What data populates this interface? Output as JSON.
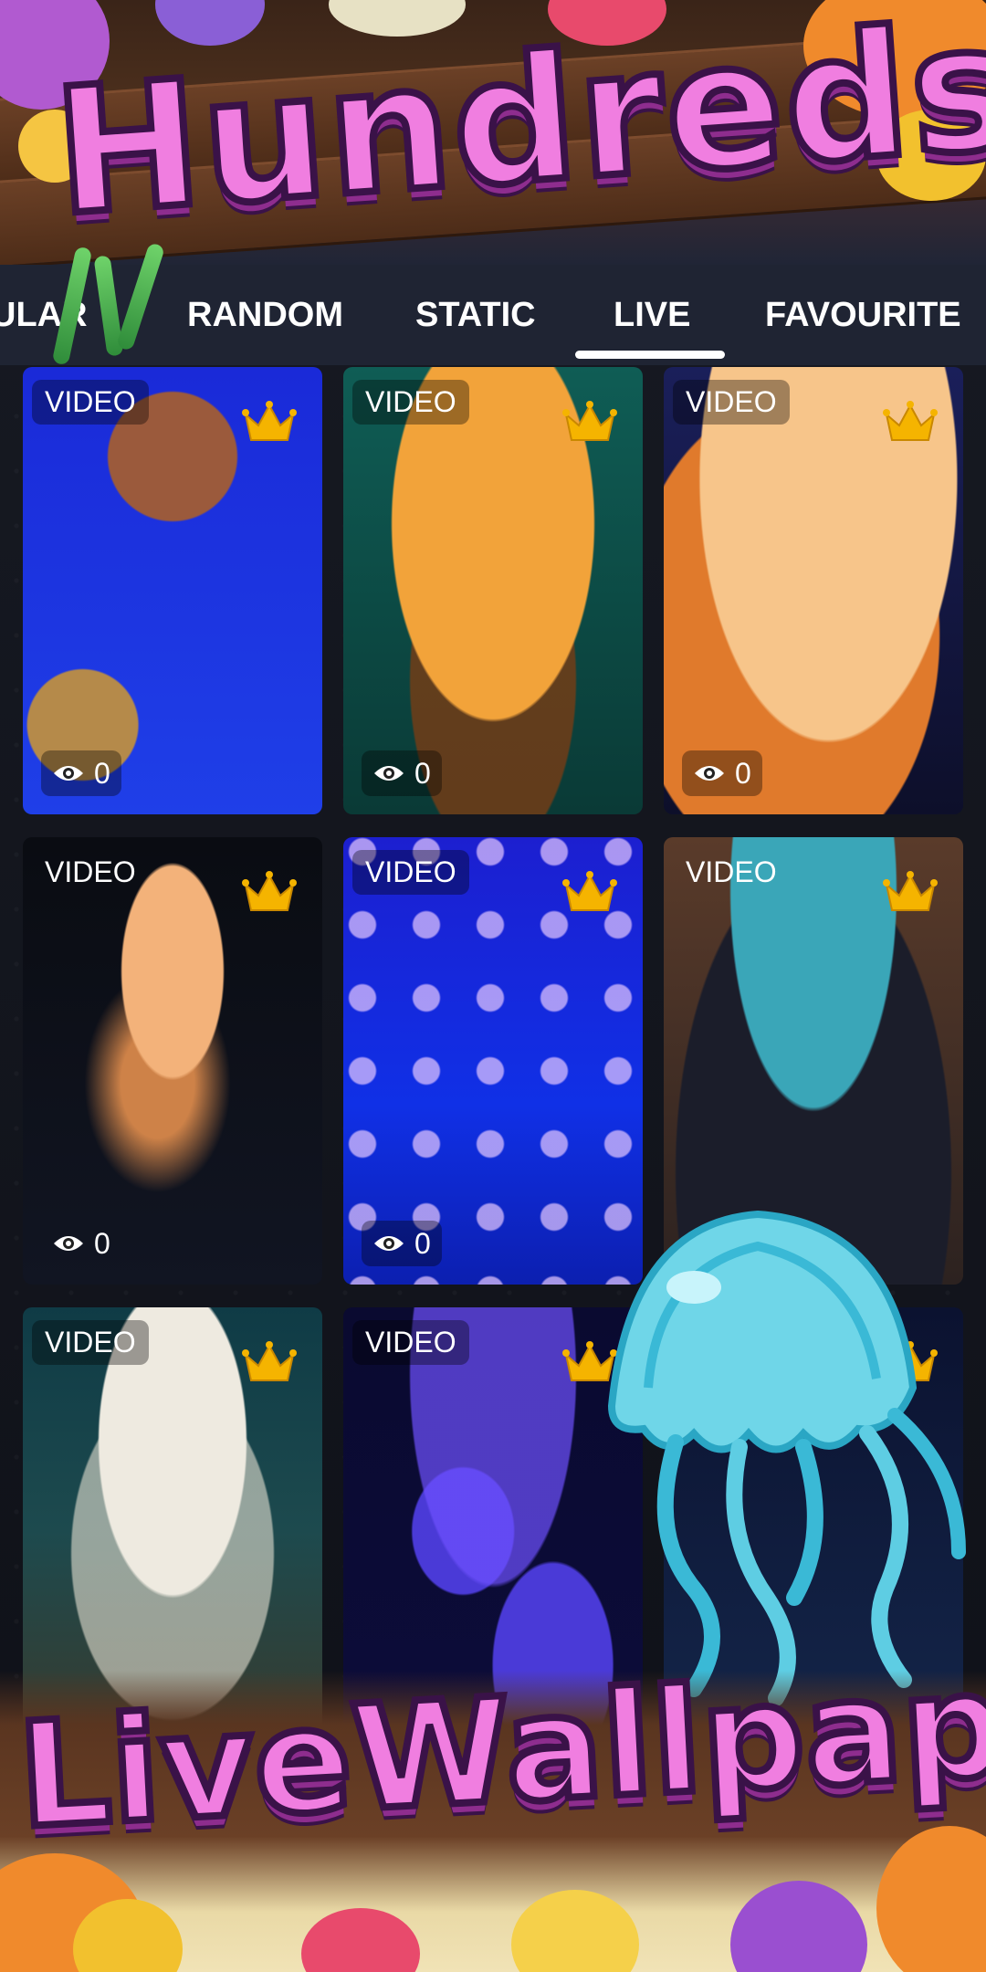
{
  "banner": {
    "top_title": "Hundreds+",
    "bottom_title": "LiveWallpaper"
  },
  "tabs": [
    {
      "label": "ULAR"
    },
    {
      "label": "RANDOM"
    },
    {
      "label": "STATIC"
    },
    {
      "label": "LIVE",
      "selected": true
    },
    {
      "label": "FAVOURITE"
    }
  ],
  "grid": {
    "cards": [
      {
        "badge": "VIDEO",
        "views": "0",
        "premium": true
      },
      {
        "badge": "VIDEO",
        "views": "0",
        "premium": true
      },
      {
        "badge": "VIDEO",
        "views": "0",
        "premium": true
      },
      {
        "badge": "VIDEO",
        "views": "0",
        "premium": true
      },
      {
        "badge": "VIDEO",
        "views": "0",
        "premium": true
      },
      {
        "badge": "VIDEO",
        "premium": true
      },
      {
        "badge": "VIDEO",
        "premium": true
      },
      {
        "badge": "VIDEO",
        "premium": true
      },
      {
        "premium": true
      }
    ]
  },
  "colors": {
    "accent_pink": "#f07ee0",
    "crown_gold": "#f5b400",
    "tab_bar": "#1f2433"
  }
}
